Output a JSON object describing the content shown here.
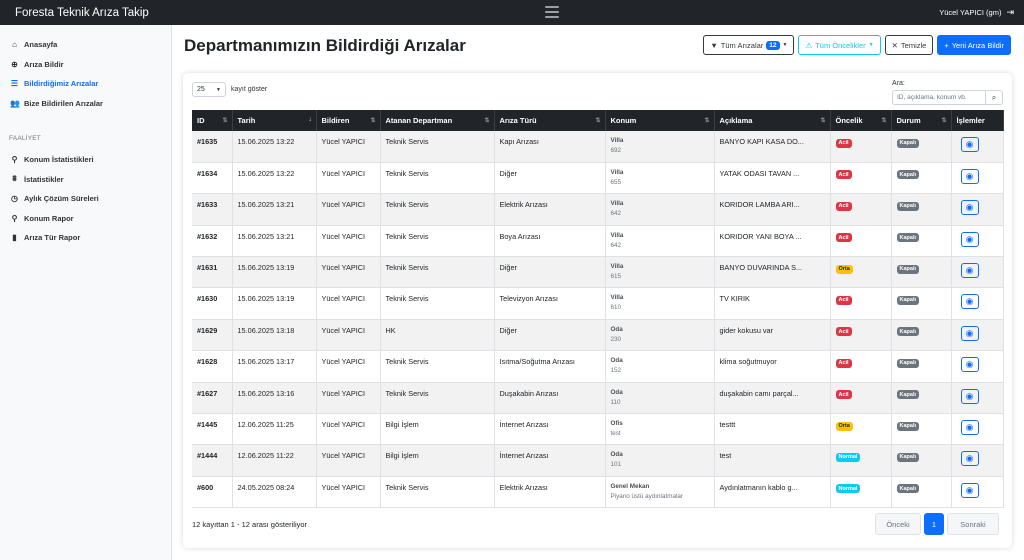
{
  "app": {
    "brand": "Foresta Teknik Arıza Takip",
    "user": "Yücel YAPICI (gm)"
  },
  "sidebar": {
    "items": [
      {
        "label": "Anasayfa",
        "icon": "home-icon",
        "active": false
      },
      {
        "label": "Arıza Bildir",
        "icon": "plus-circle-icon",
        "active": false
      },
      {
        "label": "Bildirdiğimiz Arızalar",
        "icon": "list-icon",
        "active": true
      },
      {
        "label": "Bize Bildirilen Arızalar",
        "icon": "users-icon",
        "active": false
      }
    ],
    "section_title": "FAALİYET",
    "section_items": [
      {
        "label": "Konum İstatistikleri",
        "icon": "map-marker-icon"
      },
      {
        "label": "İstatistikler",
        "icon": "chart-icon"
      },
      {
        "label": "Aylık Çözüm Süreleri",
        "icon": "clock-icon"
      },
      {
        "label": "Konum Rapor",
        "icon": "map-marker-icon"
      },
      {
        "label": "Arıza Tür Rapor",
        "icon": "chart-bar-icon"
      }
    ]
  },
  "page": {
    "title": "Departmanımızın Bildirdiği Arızalar",
    "filter_all": "Tüm Arızalar",
    "filter_count": "12",
    "filter_priority": "Tüm Öncelikler",
    "clear": "Temizle",
    "new_report": "Yeni Arıza Bildir"
  },
  "table_controls": {
    "page_length": "25",
    "page_length_suffix": "kayıt göster",
    "search_label": "Ara:",
    "search_placeholder": "ID, açıklama, konum vb."
  },
  "table": {
    "columns": [
      "ID",
      "Tarih",
      "Bildiren",
      "Atanan Departman",
      "Arıza Türü",
      "Konum",
      "Açıklama",
      "Öncelik",
      "Durum",
      "İşlemler"
    ],
    "rows": [
      {
        "id": "#1635",
        "date": "15.06.2025 13:22",
        "reporter": "Yücel YAPICI",
        "dept": "Teknik Servis",
        "type": "Kapı Arızası",
        "loc_type": "Villa",
        "loc_sub": "692",
        "desc": "BANYO KAPI KASA DO...",
        "priority": "Acil",
        "priority_class": "acil",
        "status": "Kapalı"
      },
      {
        "id": "#1634",
        "date": "15.06.2025 13:22",
        "reporter": "Yücel YAPICI",
        "dept": "Teknik Servis",
        "type": "Diğer",
        "loc_type": "Villa",
        "loc_sub": "655",
        "desc": "YATAK ODASI TAVAN ...",
        "priority": "Acil",
        "priority_class": "acil",
        "status": "Kapalı"
      },
      {
        "id": "#1633",
        "date": "15.06.2025 13:21",
        "reporter": "Yücel YAPICI",
        "dept": "Teknik Servis",
        "type": "Elektrik Arızası",
        "loc_type": "Villa",
        "loc_sub": "642",
        "desc": "KORIDOR LAMBA ARI...",
        "priority": "Acil",
        "priority_class": "acil",
        "status": "Kapalı"
      },
      {
        "id": "#1632",
        "date": "15.06.2025 13:21",
        "reporter": "Yücel YAPICI",
        "dept": "Teknik Servis",
        "type": "Boya Arızası",
        "loc_type": "Villa",
        "loc_sub": "642",
        "desc": "KORIDOR YANI BOYA ...",
        "priority": "Acil",
        "priority_class": "acil",
        "status": "Kapalı"
      },
      {
        "id": "#1631",
        "date": "15.06.2025 13:19",
        "reporter": "Yücel YAPICI",
        "dept": "Teknik Servis",
        "type": "Diğer",
        "loc_type": "Villa",
        "loc_sub": "615",
        "desc": "BANYO DUVARINDA S...",
        "priority": "Orta",
        "priority_class": "orta",
        "status": "Kapalı"
      },
      {
        "id": "#1630",
        "date": "15.06.2025 13:19",
        "reporter": "Yücel YAPICI",
        "dept": "Teknik Servis",
        "type": "Televizyon Arızası",
        "loc_type": "Villa",
        "loc_sub": "610",
        "desc": "TV KIRIK",
        "priority": "Acil",
        "priority_class": "acil",
        "status": "Kapalı"
      },
      {
        "id": "#1629",
        "date": "15.06.2025 13:18",
        "reporter": "Yücel YAPICI",
        "dept": "HK",
        "type": "Diğer",
        "loc_type": "Oda",
        "loc_sub": "230",
        "desc": "gider kokusu var",
        "priority": "Acil",
        "priority_class": "acil",
        "status": "Kapalı"
      },
      {
        "id": "#1628",
        "date": "15.06.2025 13:17",
        "reporter": "Yücel YAPICI",
        "dept": "Teknik Servis",
        "type": "Isıtma/Soğutma Arızası",
        "loc_type": "Oda",
        "loc_sub": "152",
        "desc": "klima soğutmuyor",
        "priority": "Acil",
        "priority_class": "acil",
        "status": "Kapalı"
      },
      {
        "id": "#1627",
        "date": "15.06.2025 13:16",
        "reporter": "Yücel YAPICI",
        "dept": "Teknik Servis",
        "type": "Duşakabin Arızası",
        "loc_type": "Oda",
        "loc_sub": "110",
        "desc": "duşakabin camı parçal...",
        "priority": "Acil",
        "priority_class": "acil",
        "status": "Kapalı"
      },
      {
        "id": "#1445",
        "date": "12.06.2025 11:25",
        "reporter": "Yücel YAPICI",
        "dept": "Bilgi İşlem",
        "type": "İnternet Arızası",
        "loc_type": "Ofis",
        "loc_sub": "test",
        "desc": "testtt",
        "priority": "Orta",
        "priority_class": "orta",
        "status": "Kapalı"
      },
      {
        "id": "#1444",
        "date": "12.06.2025 11:22",
        "reporter": "Yücel YAPICI",
        "dept": "Bilgi İşlem",
        "type": "İnternet Arızası",
        "loc_type": "Oda",
        "loc_sub": "101",
        "desc": "test",
        "priority": "Normal",
        "priority_class": "normal",
        "status": "Kapalı"
      },
      {
        "id": "#600",
        "date": "24.05.2025 08:24",
        "reporter": "Yücel YAPICI",
        "dept": "Teknik Servis",
        "type": "Elektrik Arızası",
        "loc_type": "Genel Mekan",
        "loc_sub": "Piyano üstü aydınlatmalar",
        "desc": "Aydınlatmanın kablo g...",
        "priority": "Normal",
        "priority_class": "normal",
        "status": "Kapalı"
      }
    ]
  },
  "footer": {
    "info": "12 kayıttan 1 - 12 arası gösteriliyor",
    "prev": "Önceki",
    "current": "1",
    "next": "Sonraki"
  },
  "colors": {
    "primary": "#0d6efd",
    "danger": "#dc3545",
    "warning": "#ffc107",
    "info": "#0dcaf0",
    "secondary": "#6c757d",
    "dark": "#212529"
  }
}
